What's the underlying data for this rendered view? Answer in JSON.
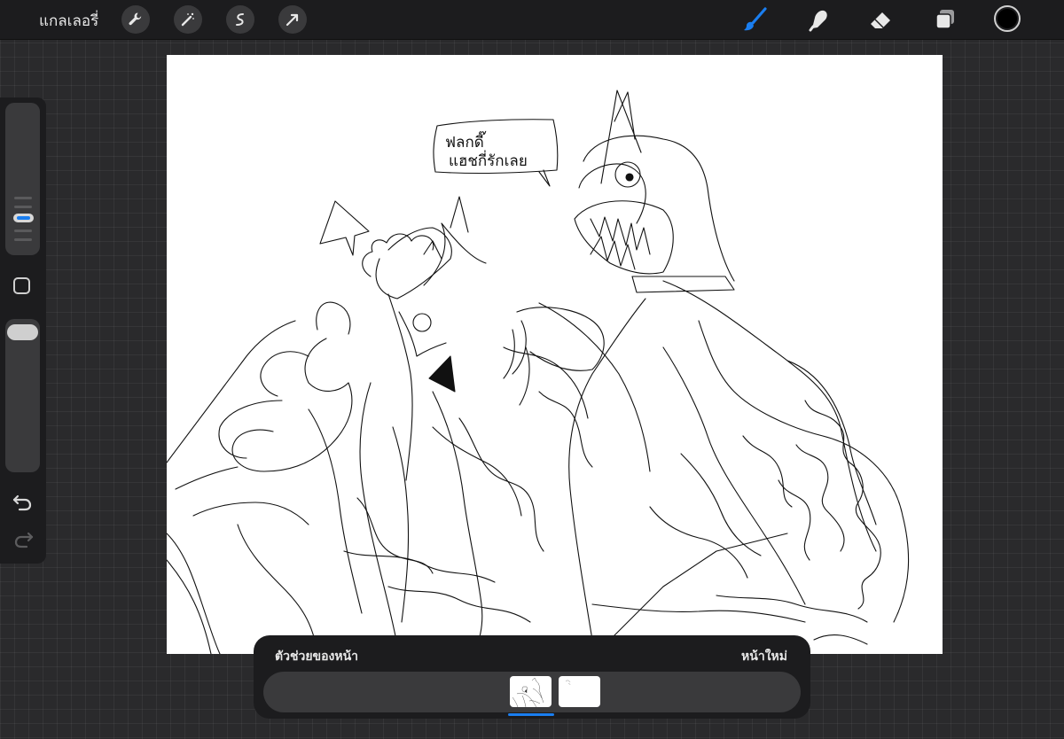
{
  "topbar": {
    "gallery_label": "แกลเลอรี่",
    "left_tools": [
      "wrench-icon",
      "magic-wand-icon",
      "selection-icon",
      "transform-arrow-icon"
    ],
    "right_tools": [
      "brush-icon",
      "smudge-icon",
      "eraser-icon",
      "layers-icon"
    ],
    "active_tool": "brush-icon",
    "current_color": "#000000",
    "accent_color": "#1a7ef0"
  },
  "sidebar": {
    "brush_size_level": 0.5,
    "brush_opacity_level": 1.0,
    "modify_button": "square-icon",
    "undo_icon": "undo-icon",
    "redo_icon": "redo-icon"
  },
  "canvas": {
    "speech_bubble_text_line1": "ฟลกดี๊",
    "speech_bubble_text_line2": "แฮชกี่รักเลย"
  },
  "page_assist": {
    "title": "ตัวช่วยของหน้า",
    "new_page_label": "หน้าใหม่",
    "pages": [
      "page-1",
      "page-2"
    ],
    "selected_page": "page-1"
  }
}
